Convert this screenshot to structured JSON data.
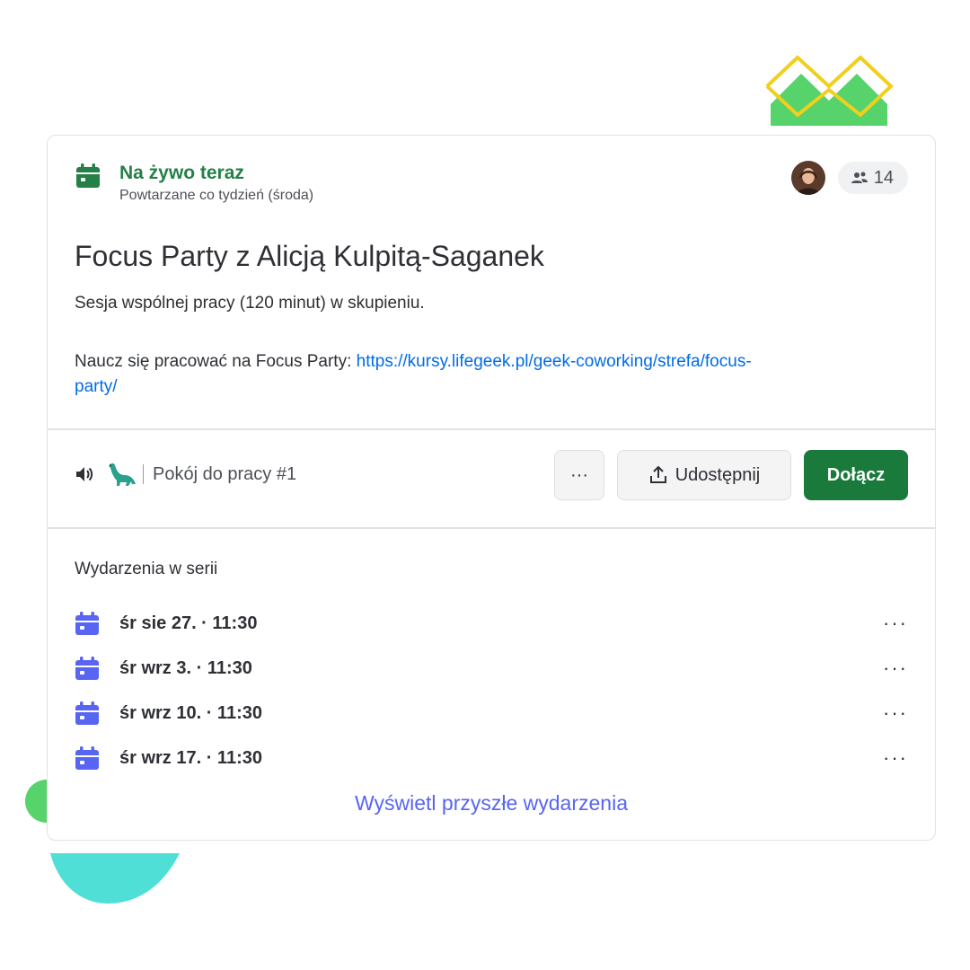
{
  "status": {
    "live_label": "Na żywo teraz",
    "recurrence": "Powtarzane co tydzień (środa)"
  },
  "attendees": {
    "count": "14"
  },
  "event": {
    "title": "Focus Party z Alicją Kulpitą-Saganek",
    "description": "Sesja wspólnej pracy (120 minut) w skupieniu.",
    "link_prefix": "Naucz się pracować na Focus Party: ",
    "link_url": "https://kursy.lifegeek.pl/geek-coworking/strefa/focus-party/"
  },
  "channel": {
    "name": "Pokój do pracy #1",
    "icons": [
      "speaker-icon",
      "dinosaur-emoji"
    ]
  },
  "actions": {
    "more_label": "···",
    "share_label": "Udostępnij",
    "join_label": "Dołącz"
  },
  "series": {
    "heading": "Wydarzenia w serii",
    "items": [
      {
        "date": "śr sie 27. · 11:30",
        "menu": "···"
      },
      {
        "date": "śr wrz 3. · 11:30",
        "menu": "···"
      },
      {
        "date": "śr wrz 10. · 11:30",
        "menu": "···"
      },
      {
        "date": "śr wrz 17. · 11:30",
        "menu": "···"
      }
    ],
    "view_more": "Wyświetl przyszłe wydarzenia"
  },
  "colors": {
    "live_green": "#248046",
    "join_button": "#1a7a3c",
    "link_blue": "#006ce7",
    "blurple": "#5865f2",
    "calendar_icon": "#5865f2"
  }
}
